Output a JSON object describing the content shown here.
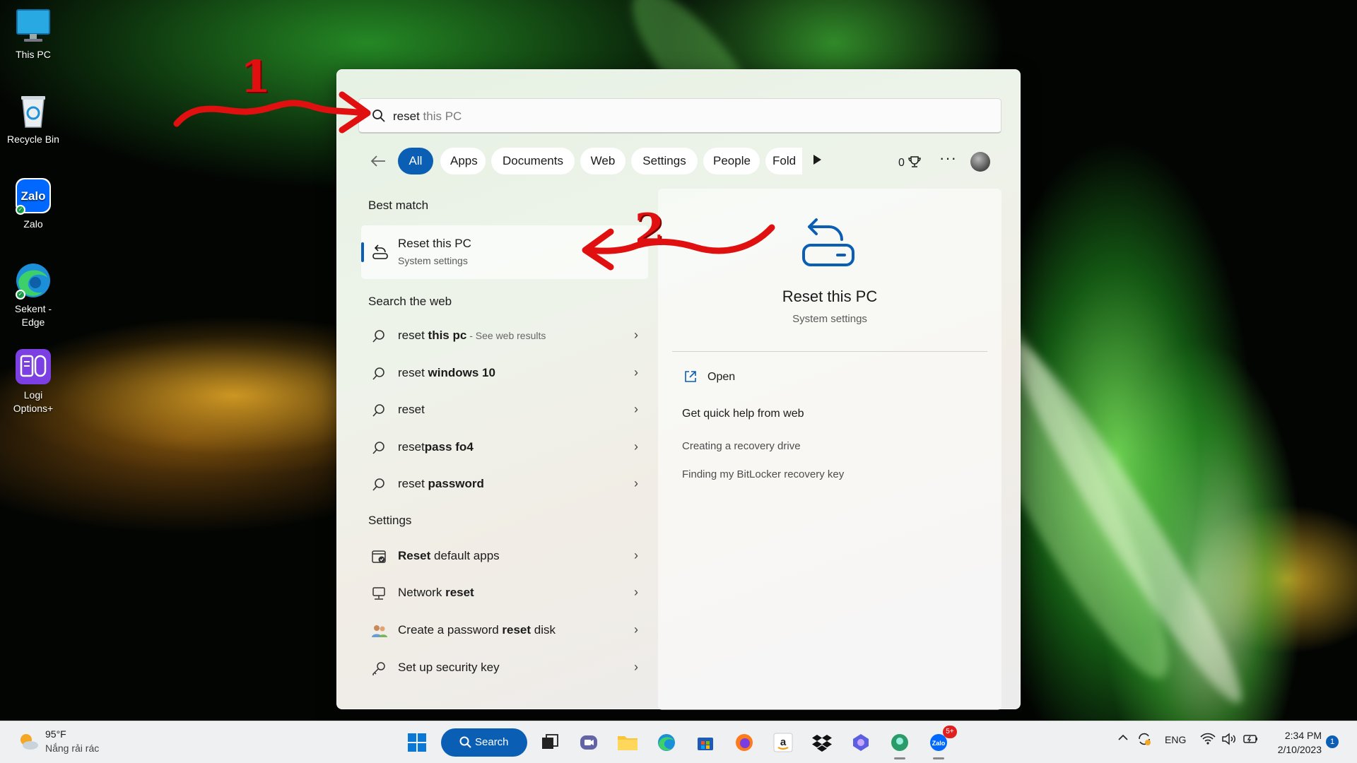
{
  "desktop": {
    "icons": [
      {
        "label": "This PC",
        "icon": "monitor-icon"
      },
      {
        "label": "Recycle Bin",
        "icon": "recycle-bin-icon"
      },
      {
        "label": "Zalo",
        "icon": "zalo-icon"
      },
      {
        "label": "Sekent -\nEdge",
        "label_line1": "Sekent -",
        "label_line2": "Edge",
        "icon": "edge-icon"
      },
      {
        "label_line1": "Logi",
        "label_line2": "Options+",
        "icon": "logi-options-icon"
      }
    ]
  },
  "search": {
    "typed": "reset",
    "suggestion": " this PC",
    "filters": [
      "All",
      "Apps",
      "Documents",
      "Web",
      "Settings",
      "People",
      "Fold"
    ],
    "active_filter": "All",
    "points": "0",
    "more_label": "···"
  },
  "best_match": {
    "heading": "Best match",
    "title": "Reset this PC",
    "subtitle": "System settings"
  },
  "web": {
    "heading": "Search the web",
    "items": [
      {
        "prefix": "reset ",
        "bold": "this pc",
        "suffix": " - See web results"
      },
      {
        "prefix": "reset ",
        "bold": "windows 10",
        "suffix": ""
      },
      {
        "prefix": "reset",
        "bold": "",
        "suffix": ""
      },
      {
        "prefix": "reset",
        "bold": "pass fo4",
        "suffix": ""
      },
      {
        "prefix": "reset ",
        "bold": "password",
        "suffix": ""
      }
    ]
  },
  "settings": {
    "heading": "Settings",
    "items": [
      {
        "prefix": "",
        "bold": "Reset",
        "suffix": " default apps",
        "icon": "default-apps-icon"
      },
      {
        "prefix": "Network ",
        "bold": "reset",
        "suffix": "",
        "icon": "network-icon"
      },
      {
        "prefix": "Create a password ",
        "bold": "reset",
        "suffix": " disk",
        "icon": "users-icon"
      },
      {
        "prefix": "Set up security key",
        "bold": "",
        "suffix": "",
        "icon": "key-icon"
      }
    ]
  },
  "detail": {
    "title": "Reset this PC",
    "subtitle": "System settings",
    "open_label": "Open",
    "help_heading": "Get quick help from web",
    "links": [
      "Creating a recovery drive",
      "Finding my BitLocker recovery key"
    ]
  },
  "annotations": {
    "step1": "1",
    "step2": "2"
  },
  "taskbar": {
    "weather_temp": "95°F",
    "weather_desc": "Nắng rải rác",
    "search_label": "Search",
    "language": "ENG",
    "time": "2:34 PM",
    "date": "2/10/2023",
    "notification_count": "1",
    "zalo_badge": "5+"
  },
  "colors": {
    "accent": "#0a5fb4",
    "annotation": "#e01010"
  }
}
